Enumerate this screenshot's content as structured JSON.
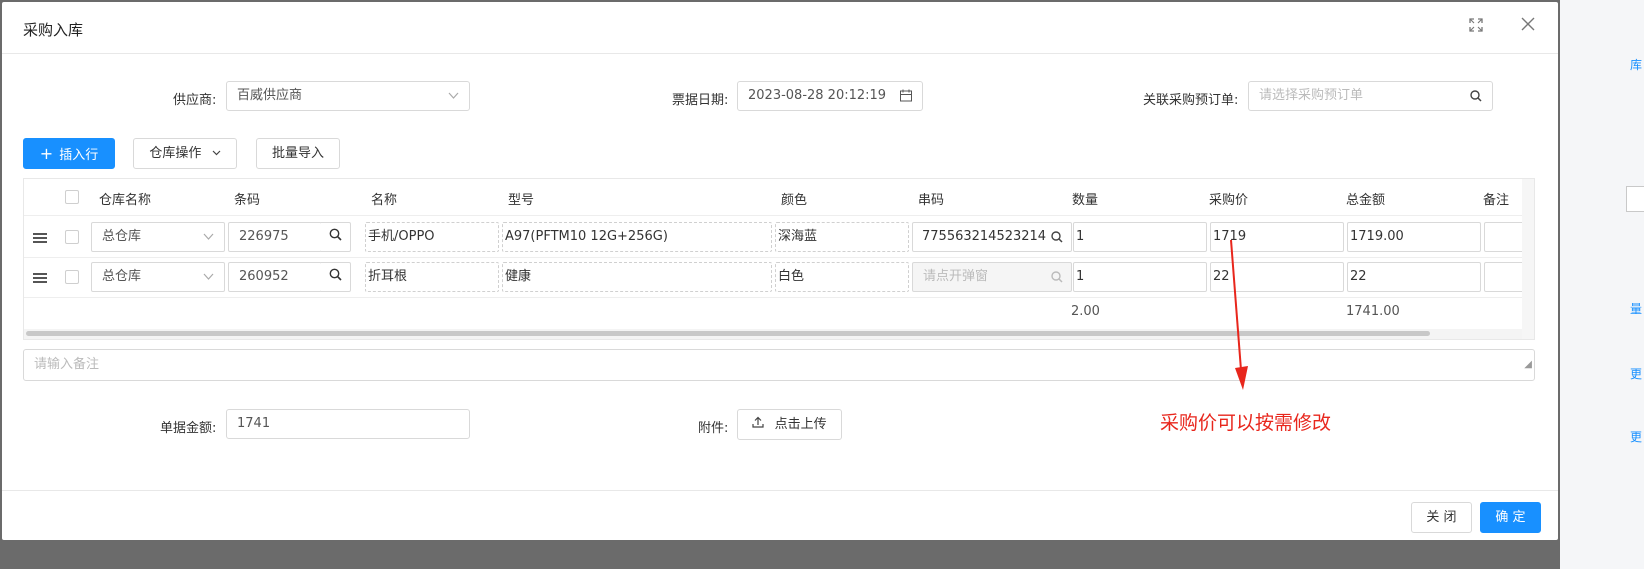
{
  "dialog": {
    "title": "采购入库"
  },
  "form": {
    "supplier_label": "供应商:",
    "supplier_value": "百威供应商",
    "date_label": "票据日期:",
    "date_value": "2023-08-28 20:12:19",
    "order_label": "关联采购预订单:",
    "order_placeholder": "请选择采购预订单"
  },
  "toolbar": {
    "insert_label": "插入行",
    "warehouse_ops_label": "仓库操作",
    "batch_import_label": "批量导入"
  },
  "table": {
    "headers": [
      "仓库名称",
      "条码",
      "名称",
      "型号",
      "颜色",
      "串码",
      "数量",
      "采购价",
      "总金额",
      "备注"
    ],
    "rows": [
      {
        "warehouse": "总仓库",
        "barcode": "226975",
        "name": "手机/OPPO",
        "model": "A97(PFTM10 12G+256G)",
        "color": "深海蓝",
        "serial": "775563214523214",
        "qty": "1",
        "price": "1719",
        "total": "1719.00"
      },
      {
        "warehouse": "总仓库",
        "barcode": "260952",
        "name": "折耳根",
        "model": "健康",
        "color": "白色",
        "serial_placeholder": "请点开弹窗",
        "qty": "1",
        "price": "22",
        "total": "22"
      }
    ],
    "summary": {
      "qty": "2.00",
      "total": "1741.00"
    }
  },
  "remark": {
    "placeholder": "请输入备注"
  },
  "bottom": {
    "amount_label": "单据金额:",
    "amount_value": "1741",
    "attachment_label": "附件:",
    "upload_label": "点击上传"
  },
  "annotation": {
    "text": "采购价可以按需修改",
    "color": "#e8261c"
  },
  "footer": {
    "close_label": "关 闭",
    "ok_label": "确 定"
  },
  "backdrop": {
    "fragments": [
      "库",
      "量",
      "更",
      "更"
    ]
  },
  "colors": {
    "primary": "#1890ff"
  }
}
